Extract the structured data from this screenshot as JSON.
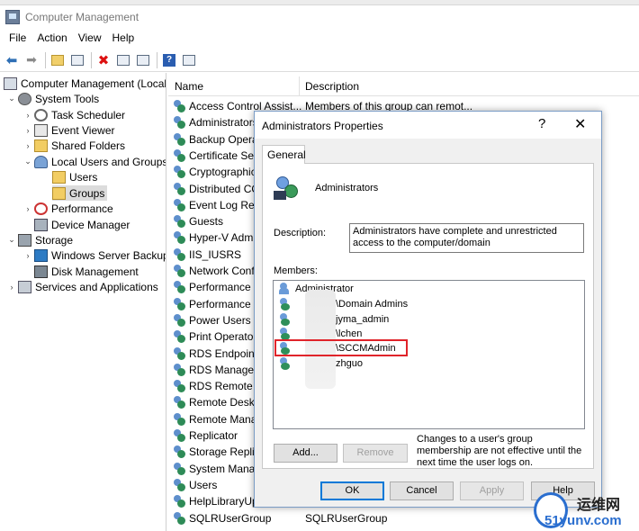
{
  "window": {
    "title": "Computer Management",
    "menu": [
      "File",
      "Action",
      "View",
      "Help"
    ]
  },
  "toolbar": {
    "buttons": [
      "back-icon",
      "forward-icon",
      "up-folder-icon",
      "show-hide-tree-icon",
      "delete-icon",
      "properties-icon",
      "export-icon",
      "help-icon",
      "show-action-pane-icon"
    ]
  },
  "tree": {
    "root": "Computer Management (Local",
    "system_tools": "System Tools",
    "task_scheduler": "Task Scheduler",
    "event_viewer": "Event Viewer",
    "shared_folders": "Shared Folders",
    "local_users_groups": "Local Users and Groups",
    "users": "Users",
    "groups": "Groups",
    "performance": "Performance",
    "device_manager": "Device Manager",
    "storage": "Storage",
    "windows_server_backup": "Windows Server Backup",
    "disk_management": "Disk Management",
    "services_apps": "Services and Applications"
  },
  "list": {
    "col_name": "Name",
    "col_desc": "Description",
    "rows": [
      {
        "name": "Access Control Assist...",
        "desc": "Members of this group can remot..."
      },
      {
        "name": "Administrators",
        "desc": ""
      },
      {
        "name": "Backup Operators",
        "desc": ""
      },
      {
        "name": "Certificate Service DCOM Access",
        "desc": ""
      },
      {
        "name": "Cryptographic Operators",
        "desc": ""
      },
      {
        "name": "Distributed COM Users",
        "desc": ""
      },
      {
        "name": "Event Log Readers",
        "desc": ""
      },
      {
        "name": "Guests",
        "desc": ""
      },
      {
        "name": "Hyper-V Administrators",
        "desc": ""
      },
      {
        "name": "IIS_IUSRS",
        "desc": ""
      },
      {
        "name": "Network Configuration Operators",
        "desc": ""
      },
      {
        "name": "Performance Log Users",
        "desc": ""
      },
      {
        "name": "Performance Monitor Users",
        "desc": ""
      },
      {
        "name": "Power Users",
        "desc": ""
      },
      {
        "name": "Print Operators",
        "desc": ""
      },
      {
        "name": "RDS Endpoint Servers",
        "desc": ""
      },
      {
        "name": "RDS Management Servers",
        "desc": ""
      },
      {
        "name": "RDS Remote Access Servers",
        "desc": ""
      },
      {
        "name": "Remote Desktop Users",
        "desc": ""
      },
      {
        "name": "Remote Management Users",
        "desc": ""
      },
      {
        "name": "Replicator",
        "desc": ""
      },
      {
        "name": "Storage Replica Administrators",
        "desc": ""
      },
      {
        "name": "System Managed Accounts Group",
        "desc": ""
      },
      {
        "name": "Users",
        "desc": ""
      },
      {
        "name": "HelpLibraryUpdaters",
        "desc": ""
      },
      {
        "name": "SQLRUserGroup",
        "desc": "SQLRUserGroup"
      }
    ]
  },
  "dialog": {
    "title": "Administrators Properties",
    "help_glyph": "?",
    "close_glyph": "✕",
    "tab": "General",
    "group_name": "Administrators",
    "description_label": "Description:",
    "description": "Administrators have complete and unrestricted access to the computer/domain",
    "members_label": "Members:",
    "members": [
      "Administrator",
      "\\Domain Admins",
      "jyma_admin",
      "\\lchen",
      "\\SCCMAdmin",
      "zhguo"
    ],
    "add_label": "Add...",
    "remove_label": "Remove",
    "note": "Changes to a user's group membership are not effective until the next time the user logs on.",
    "ok_label": "OK",
    "cancel_label": "Cancel",
    "apply_label": "Apply",
    "help_label": "Help"
  },
  "watermark": {
    "cn": "运维网",
    "en": "51yunv.com"
  }
}
